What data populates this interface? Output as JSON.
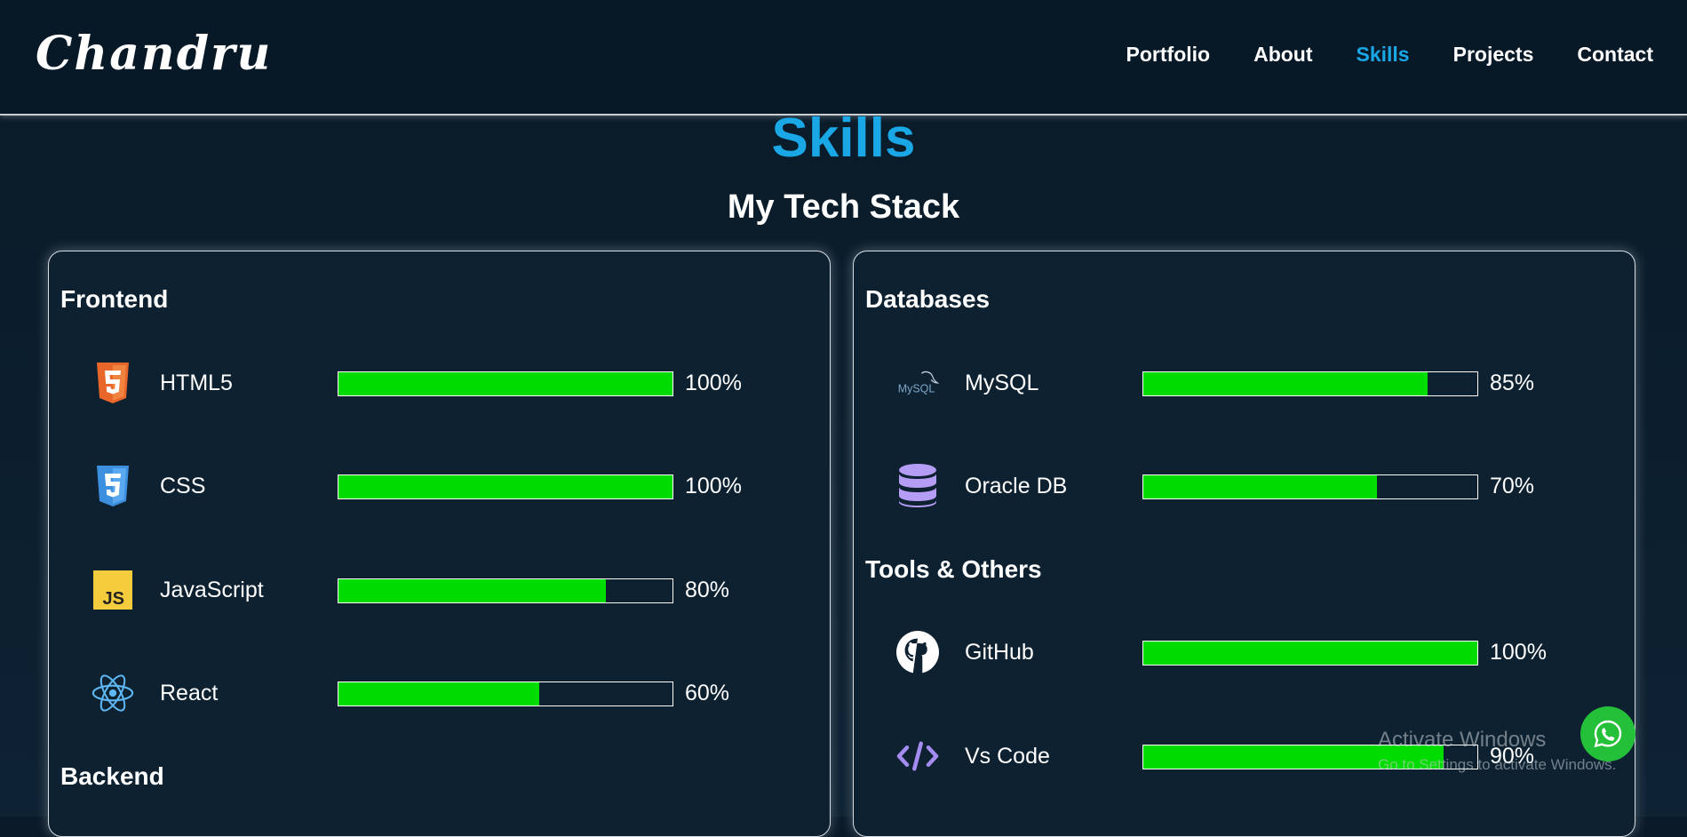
{
  "brand": {
    "logo_text": "Chandru"
  },
  "nav": {
    "items": [
      {
        "label": "Portfolio",
        "active": false
      },
      {
        "label": "About",
        "active": false
      },
      {
        "label": "Skills",
        "active": true
      },
      {
        "label": "Projects",
        "active": false
      },
      {
        "label": "Contact",
        "active": false
      }
    ]
  },
  "colors": {
    "accent": "#1aa7e6",
    "bar_fill": "#00dc00",
    "whatsapp": "#25c03a"
  },
  "section": {
    "title": "Skills",
    "subtitle": "My Tech Stack"
  },
  "left_card": {
    "groups": [
      {
        "title": "Frontend",
        "skills": [
          {
            "name": "HTML5",
            "percent_label": "100%",
            "level": 100,
            "icon": "html5-icon"
          },
          {
            "name": "CSS",
            "percent_label": "100%",
            "level": 100,
            "icon": "css3-icon"
          },
          {
            "name": "JavaScript",
            "percent_label": "80%",
            "level": 80,
            "icon": "javascript-icon"
          },
          {
            "name": "React",
            "percent_label": "60%",
            "level": 60,
            "icon": "react-icon"
          }
        ]
      },
      {
        "title": "Backend",
        "skills": []
      }
    ]
  },
  "right_card": {
    "groups": [
      {
        "title": "Databases",
        "skills": [
          {
            "name": "MySQL",
            "percent_label": "85%",
            "level": 85,
            "icon": "mysql-icon",
            "icon_text": "MySQL"
          },
          {
            "name": "Oracle DB",
            "percent_label": "70%",
            "level": 70,
            "icon": "database-icon"
          }
        ]
      },
      {
        "title": "Tools & Others",
        "skills": [
          {
            "name": "GitHub",
            "percent_label": "100%",
            "level": 100,
            "icon": "github-icon"
          },
          {
            "name": "Vs Code",
            "percent_label": "90%",
            "level": 90,
            "icon": "code-icon"
          }
        ]
      }
    ]
  },
  "windows_watermark": {
    "line1": "Activate Windows",
    "line2": "Go to Settings to activate Windows."
  },
  "whatsapp": {
    "icon": "whatsapp-icon"
  }
}
